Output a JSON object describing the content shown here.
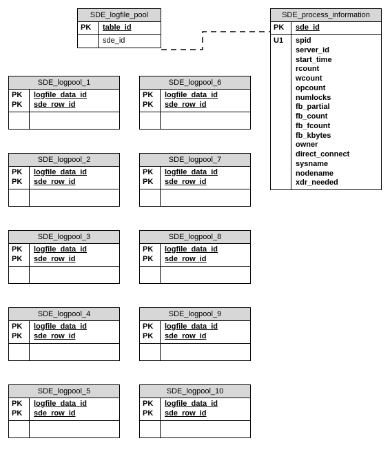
{
  "tables": {
    "logfile_pool": {
      "title": "SDE_logfile_pool",
      "key1": "PK",
      "field1": "table_id",
      "field2": "sde_id"
    },
    "process_info": {
      "title": "SDE_process_information",
      "key1": "PK",
      "field1": "sde_id",
      "key2": "U1",
      "fields": [
        "spid",
        "server_id",
        "start_time",
        "rcount",
        "wcount",
        "opcount",
        "numlocks",
        "fb_partial",
        "fb_count",
        "fb_fcount",
        "fb_kbytes",
        "owner",
        "direct_connect",
        "sysname",
        "nodename",
        "xdr_needed"
      ]
    },
    "logpool": {
      "keyA": "PK",
      "keyB": "PK",
      "fieldA": "logfile_data_id",
      "fieldB": "sde_row_id"
    },
    "logpool_titles": {
      "1": "SDE_logpool_1",
      "2": "SDE_logpool_2",
      "3": "SDE_logpool_3",
      "4": "SDE_logpool_4",
      "5": "SDE_logpool_5",
      "6": "SDE_logpool_6",
      "7": "SDE_logpool_7",
      "8": "SDE_logpool_8",
      "9": "SDE_logpool_9",
      "10": "SDE_logpool_10"
    }
  }
}
